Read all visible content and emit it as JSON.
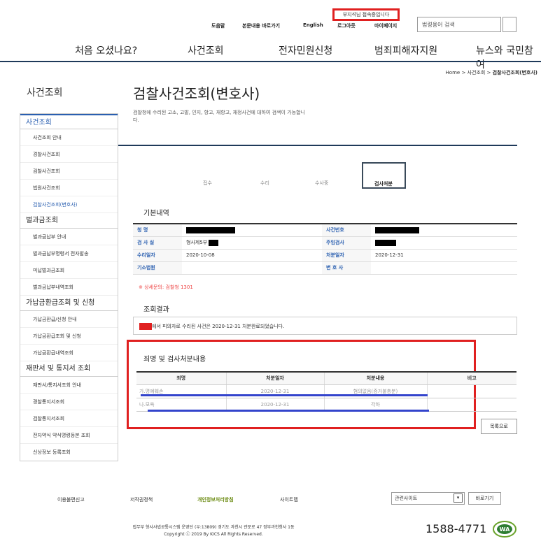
{
  "header": {
    "user_status": "부지석님 접속중입니다",
    "util_links": [
      "도움말",
      "본문내용 바로가기",
      "English",
      "로그아웃",
      "마이페이지"
    ],
    "search_placeholder": "법령용어 검색",
    "gnb": [
      "처음 오셨나요?",
      "사건조회",
      "전자민원신청",
      "범죄피해자지원",
      "뉴스와 국민참여"
    ]
  },
  "breadcrumb": {
    "home": "Home",
    "level1": "사건조회",
    "current": "검찰사건조회(변호사)"
  },
  "sidebar": {
    "title": "사건조회",
    "groups": [
      {
        "label": "사건조회",
        "active": true,
        "items": [
          "사건조회 안내",
          "경찰사건조회",
          "검찰사건조회",
          "법원사건조회",
          "검찰사건조회(변호사)"
        ]
      },
      {
        "label": "벌과금조회",
        "active": false,
        "items": [
          "벌과금납부 안내",
          "벌과금납부명령서 전자발송",
          "미납벌과금조회",
          "벌과금납부내역조회"
        ]
      },
      {
        "label": "가납금환급조회 및 신청",
        "active": false,
        "items": [
          "가납금환급/신청 안내",
          "가납금환급조회 및 신청",
          "가납금환급내역조회"
        ]
      },
      {
        "label": "재판서 및 통지서 조회",
        "active": false,
        "items": [
          "재판서/통지서조회 안내",
          "경찰통지서조회",
          "검찰통지서조회",
          "전자약식 약식명령등본 조회",
          "신상정보 등록조회"
        ]
      }
    ],
    "active_item": "검찰사건조회(변호사)"
  },
  "main": {
    "title": "검찰사건조회(변호사)",
    "desc": "검찰청에 수리된 고소, 고발, 인지, 항고, 재항고, 재정사건에 대하여 검색이 가능합니다.",
    "steps": [
      "접수",
      "수리",
      "수사중",
      "검사처분"
    ],
    "basic_title": "기본내역",
    "basic": {
      "name_label": "청    명",
      "case_no_label": "사건번호",
      "dept_label": "검 사 실",
      "dept_value": "형사제5부",
      "prosecutor_label": "주임검사",
      "recv_date_label": "수리일자",
      "recv_date_value": "2020-10-08",
      "disp_date_label": "처분일자",
      "disp_date_value": "2020-12-31",
      "court_label": "기소법원",
      "lawyer_label": "변 호 사"
    },
    "note": "※ 상세문의: 검찰청 1301",
    "result_title": "조회결과",
    "result_text": "에서 피의자로 수리된 사건은 2020-12-31 처분완료되었습니다.",
    "charge_title": "죄명 및 검사처분내용",
    "charge_headers": [
      "죄명",
      "처분일자",
      "처분내용",
      "비고"
    ],
    "charge_rows": [
      {
        "crime": "가.명예훼손",
        "date": "2020-12-31",
        "result": "혐의없음(증거불충분)",
        "note": ""
      },
      {
        "crime": "나.모욕",
        "date": "2020-12-31",
        "result": "각하",
        "note": ""
      }
    ],
    "list_button": "목록으로"
  },
  "footer": {
    "links": [
      "이용불편신고",
      "저작권정책",
      "개인정보처리방침",
      "사이트맵"
    ],
    "related_label": "관련사이트",
    "go_label": "바로가기",
    "address": "법무부 형사사법공통시스템 운영단 (우:13809) 경기도 과천시 관문로 47 정부과천청사 1동",
    "copyright": "Copyright ⓒ 2019 By KICS All Rights Reserved.",
    "phone": "1588-4771",
    "logo_text": "WA"
  }
}
